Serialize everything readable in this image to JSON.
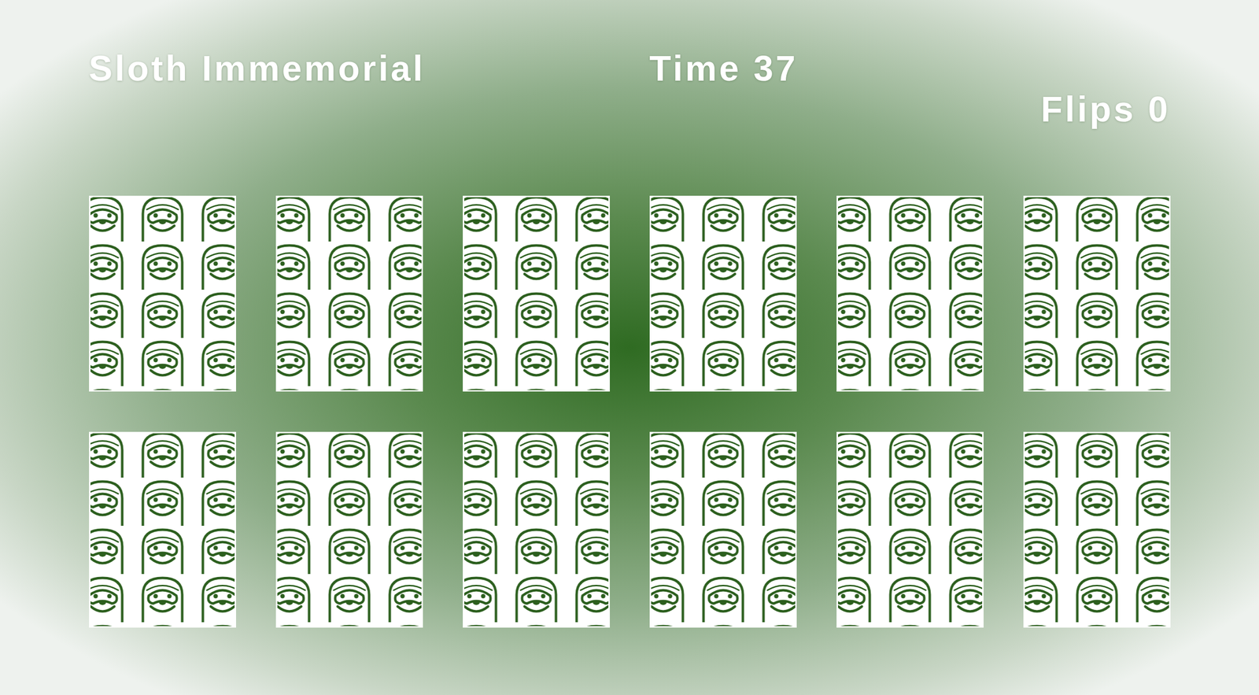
{
  "game": {
    "title": "Sloth Immemorial",
    "time": "Time 37",
    "flips": "Flips 0"
  },
  "cards": [
    {
      "flipped": false
    },
    {
      "flipped": false
    },
    {
      "flipped": false
    },
    {
      "flipped": false
    },
    {
      "flipped": false
    },
    {
      "flipped": false
    },
    {
      "flipped": false
    },
    {
      "flipped": false
    },
    {
      "flipped": false
    },
    {
      "flipped": false
    },
    {
      "flipped": false
    },
    {
      "flipped": false
    }
  ]
}
